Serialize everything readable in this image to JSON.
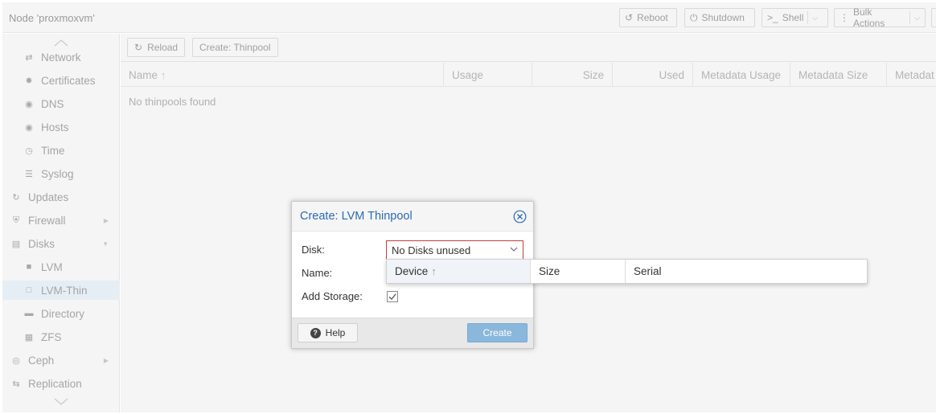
{
  "topbar": {
    "node_title": "Node 'proxmoxvm'",
    "buttons": {
      "reboot": "Reboot",
      "shutdown": "Shutdown",
      "shell": "Shell",
      "bulk_actions": "Bulk Actions"
    }
  },
  "sidebar": {
    "items": [
      {
        "label": "Network",
        "icon": "exchange-icon",
        "level": 2
      },
      {
        "label": "Certificates",
        "icon": "certificate-icon",
        "level": 2
      },
      {
        "label": "DNS",
        "icon": "globe-icon",
        "level": 2
      },
      {
        "label": "Hosts",
        "icon": "globe-icon",
        "level": 2
      },
      {
        "label": "Time",
        "icon": "clock-icon",
        "level": 2
      },
      {
        "label": "Syslog",
        "icon": "list-icon",
        "level": 2
      },
      {
        "label": "Updates",
        "icon": "refresh-icon",
        "level": 1
      },
      {
        "label": "Firewall",
        "icon": "shield-icon",
        "level": 1,
        "expander": "right"
      },
      {
        "label": "Disks",
        "icon": "hdd-icon",
        "level": 1,
        "expander": "down"
      },
      {
        "label": "LVM",
        "icon": "square-icon",
        "level": 2
      },
      {
        "label": "LVM-Thin",
        "icon": "square-outline-icon",
        "level": 2,
        "active": true
      },
      {
        "label": "Directory",
        "icon": "folder-icon",
        "level": 2
      },
      {
        "label": "ZFS",
        "icon": "grid-icon",
        "level": 2
      },
      {
        "label": "Ceph",
        "icon": "ceph-icon",
        "level": 1,
        "expander": "right"
      },
      {
        "label": "Replication",
        "icon": "retweet-icon",
        "level": 1
      }
    ]
  },
  "content": {
    "toolbar": {
      "reload": "Reload",
      "create_thinpool": "Create: Thinpool"
    },
    "columns": [
      "Name",
      "Usage",
      "Size",
      "Used",
      "Metadata Usage",
      "Metadata Size",
      "Metadat"
    ],
    "empty_text": "No thinpools found"
  },
  "dialog": {
    "title": "Create: LVM Thinpool",
    "disk_label": "Disk:",
    "disk_value": "No Disks unused",
    "name_label": "Name:",
    "add_storage_label": "Add Storage:",
    "add_storage_checked": true,
    "help_label": "Help",
    "create_label": "Create"
  },
  "picker": {
    "columns": [
      "Device",
      "Size",
      "Serial"
    ]
  },
  "colors": {
    "dialog_title": "#2c6bb0",
    "create_button": "#8ab7dc",
    "invalid_border": "#c33e3e"
  }
}
